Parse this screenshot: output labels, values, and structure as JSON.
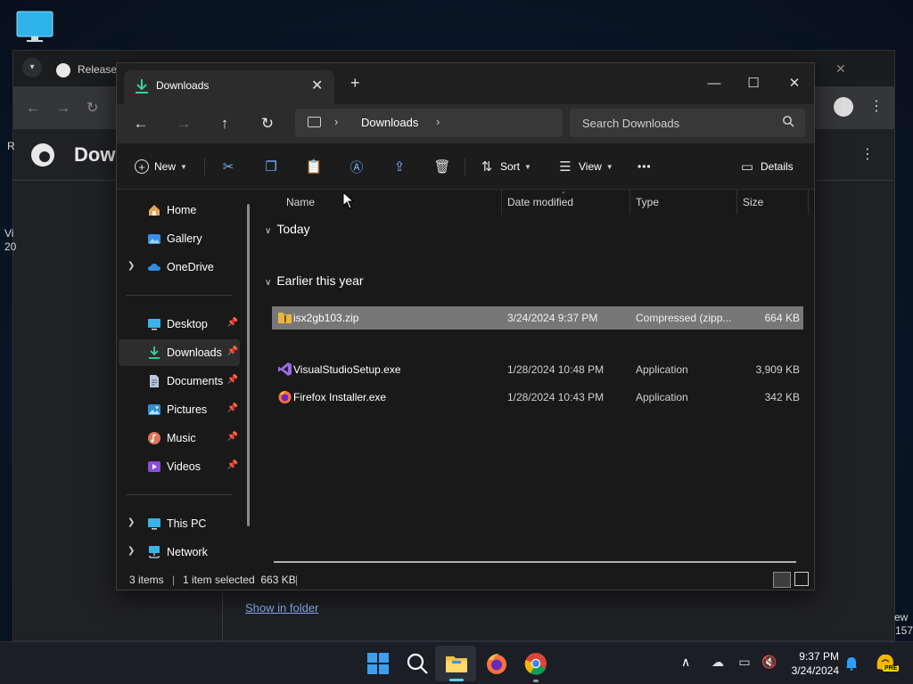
{
  "browser": {
    "tab_title": "Releases",
    "page_title": "Dow",
    "show_in_folder": "Show in folder"
  },
  "desktop": {
    "stray_text": [
      "R",
      "Vi",
      "20",
      "ew",
      "157"
    ]
  },
  "explorer": {
    "tab": {
      "label": "Downloads",
      "close": "✕",
      "new_tab": "+"
    },
    "window_controls": {
      "minimize": "—",
      "maximize": "☐",
      "close": "✕"
    },
    "nav": {
      "back": "←",
      "forward": "→",
      "up": "↑",
      "refresh": "↻"
    },
    "address": {
      "chevron": "›",
      "current": "Downloads"
    },
    "search": {
      "placeholder": "Search Downloads"
    },
    "commands": {
      "new": "New",
      "sort": "Sort",
      "view": "View",
      "more": "•••",
      "details": "Details"
    },
    "nav_pane": {
      "items": [
        {
          "label": "Home",
          "icon": "home-icon"
        },
        {
          "label": "Gallery",
          "icon": "gallery-icon"
        },
        {
          "label": "OneDrive",
          "icon": "cloud-icon",
          "expandable": true
        },
        {
          "label": "Desktop",
          "icon": "desktop-icon",
          "pinned": true
        },
        {
          "label": "Downloads",
          "icon": "download-icon",
          "pinned": true,
          "selected": true
        },
        {
          "label": "Documents",
          "icon": "document-icon",
          "pinned": true
        },
        {
          "label": "Pictures",
          "icon": "pictures-icon",
          "pinned": true
        },
        {
          "label": "Music",
          "icon": "music-icon",
          "pinned": true
        },
        {
          "label": "Videos",
          "icon": "videos-icon",
          "pinned": true
        },
        {
          "label": "This PC",
          "icon": "pc-icon",
          "expandable": true
        },
        {
          "label": "Network",
          "icon": "network-icon",
          "expandable": true
        }
      ]
    },
    "columns": {
      "name": "Name",
      "date": "Date modified",
      "type": "Type",
      "size": "Size"
    },
    "groups": [
      {
        "label": "Today",
        "files": [
          {
            "name": "isx2gb103.zip",
            "date": "3/24/2024 9:37 PM",
            "type": "Compressed (zipp...",
            "size": "664 KB",
            "icon": "zip-folder-icon",
            "selected": true
          }
        ]
      },
      {
        "label": "Earlier this year",
        "files": [
          {
            "name": "VisualStudioSetup.exe",
            "date": "1/28/2024 10:48 PM",
            "type": "Application",
            "size": "3,909 KB",
            "icon": "visual-studio-icon"
          },
          {
            "name": "Firefox Installer.exe",
            "date": "1/28/2024 10:43 PM",
            "type": "Application",
            "size": "342 KB",
            "icon": "firefox-icon"
          }
        ]
      }
    ],
    "status": {
      "count": "3 items",
      "selection": "1 item selected  663 KB",
      "separator": "|"
    }
  },
  "taskbar": {
    "apps": [
      "start-icon",
      "search-icon",
      "file-explorer-icon",
      "firefox-icon",
      "chrome-icon"
    ],
    "clock": {
      "time": "9:37 PM",
      "date": "3/24/2024"
    },
    "copilot_badge": "PRE",
    "accent": "#60cdff"
  },
  "colors": {
    "explorer_bg": "#191919",
    "selected_row": "#777777",
    "accent_blue": "#6fb1ff"
  }
}
